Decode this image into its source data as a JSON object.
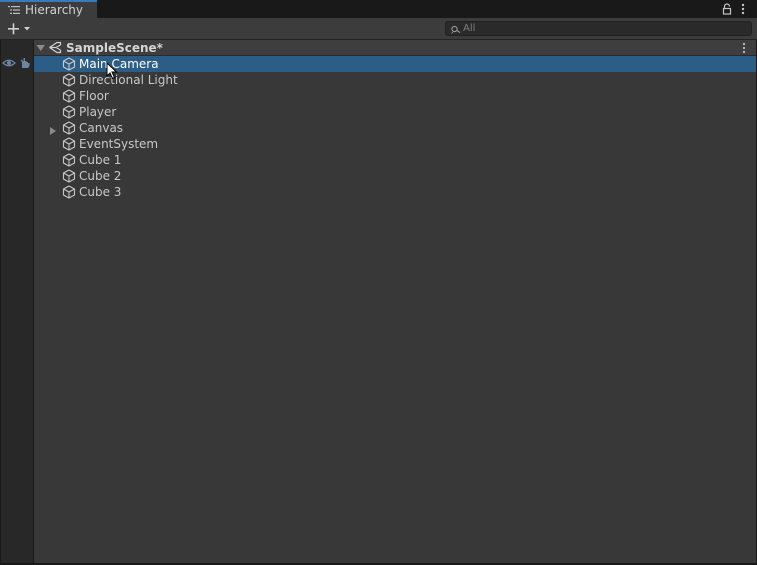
{
  "window": {
    "tab_title": "Hierarchy"
  },
  "toolbar": {
    "search_placeholder": "All"
  },
  "scene": {
    "name": "SampleScene*"
  },
  "items": [
    {
      "label": "Main Camera",
      "selected": true,
      "expandable": false
    },
    {
      "label": "Directional Light",
      "selected": false,
      "expandable": false
    },
    {
      "label": "Floor",
      "selected": false,
      "expandable": false
    },
    {
      "label": "Player",
      "selected": false,
      "expandable": false
    },
    {
      "label": "Canvas",
      "selected": false,
      "expandable": true
    },
    {
      "label": "EventSystem",
      "selected": false,
      "expandable": false
    },
    {
      "label": "Cube 1",
      "selected": false,
      "expandable": false
    },
    {
      "label": "Cube 2",
      "selected": false,
      "expandable": false
    },
    {
      "label": "Cube 3",
      "selected": false,
      "expandable": false
    }
  ],
  "colors": {
    "selection": "#2c5d87",
    "tab_accent": "#3a79bb",
    "panel_bg": "#383838"
  }
}
